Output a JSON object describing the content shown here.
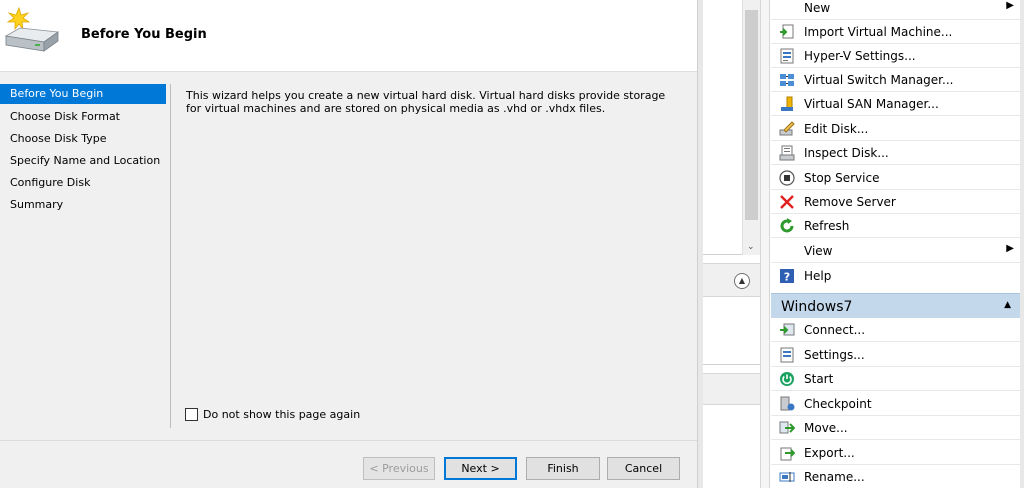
{
  "wizard": {
    "title": "Before You Begin",
    "steps": [
      {
        "label": "Before You Begin",
        "active": true
      },
      {
        "label": "Choose Disk Format",
        "active": false
      },
      {
        "label": "Choose Disk Type",
        "active": false
      },
      {
        "label": "Specify Name and Location",
        "active": false
      },
      {
        "label": "Configure Disk",
        "active": false
      },
      {
        "label": "Summary",
        "active": false
      }
    ],
    "description": "This wizard helps you create a new virtual hard disk. Virtual hard disks provide storage for virtual machines and are stored on physical media as .vhd or .vhdx files.",
    "dont_show_label": "Do not show this page again",
    "dont_show_checked": false,
    "buttons": {
      "previous": "< Previous",
      "next": "Next >",
      "finish": "Finish",
      "cancel": "Cancel"
    },
    "accent_color": "#0078d7"
  },
  "actions": {
    "items": [
      {
        "label": "New",
        "icon": "none",
        "submenu": true
      },
      {
        "label": "Import Virtual Machine...",
        "icon": "import-icon",
        "submenu": false
      },
      {
        "label": "Hyper-V Settings...",
        "icon": "hyperv-settings-icon",
        "submenu": false
      },
      {
        "label": "Virtual Switch Manager...",
        "icon": "switch-icon",
        "submenu": false
      },
      {
        "label": "Virtual SAN Manager...",
        "icon": "san-icon",
        "submenu": false
      },
      {
        "label": "Edit Disk...",
        "icon": "edit-disk-icon",
        "submenu": false
      },
      {
        "label": "Inspect Disk...",
        "icon": "inspect-disk-icon",
        "submenu": false
      },
      {
        "label": "Stop Service",
        "icon": "stop-icon",
        "submenu": false
      },
      {
        "label": "Remove Server",
        "icon": "remove-icon",
        "submenu": false
      },
      {
        "label": "Refresh",
        "icon": "refresh-icon",
        "submenu": false
      },
      {
        "label": "View",
        "icon": "none",
        "submenu": true
      },
      {
        "label": "Help",
        "icon": "help-icon",
        "submenu": false
      }
    ],
    "section_title": "Windows7",
    "vm_items": [
      {
        "label": "Connect...",
        "icon": "connect-icon"
      },
      {
        "label": "Settings...",
        "icon": "settings-icon"
      },
      {
        "label": "Start",
        "icon": "start-icon"
      },
      {
        "label": "Checkpoint",
        "icon": "checkpoint-icon"
      },
      {
        "label": "Move...",
        "icon": "move-icon"
      },
      {
        "label": "Export...",
        "icon": "export-icon"
      },
      {
        "label": "Rename...",
        "icon": "rename-icon"
      }
    ],
    "section_color": "#c4d8ec"
  }
}
